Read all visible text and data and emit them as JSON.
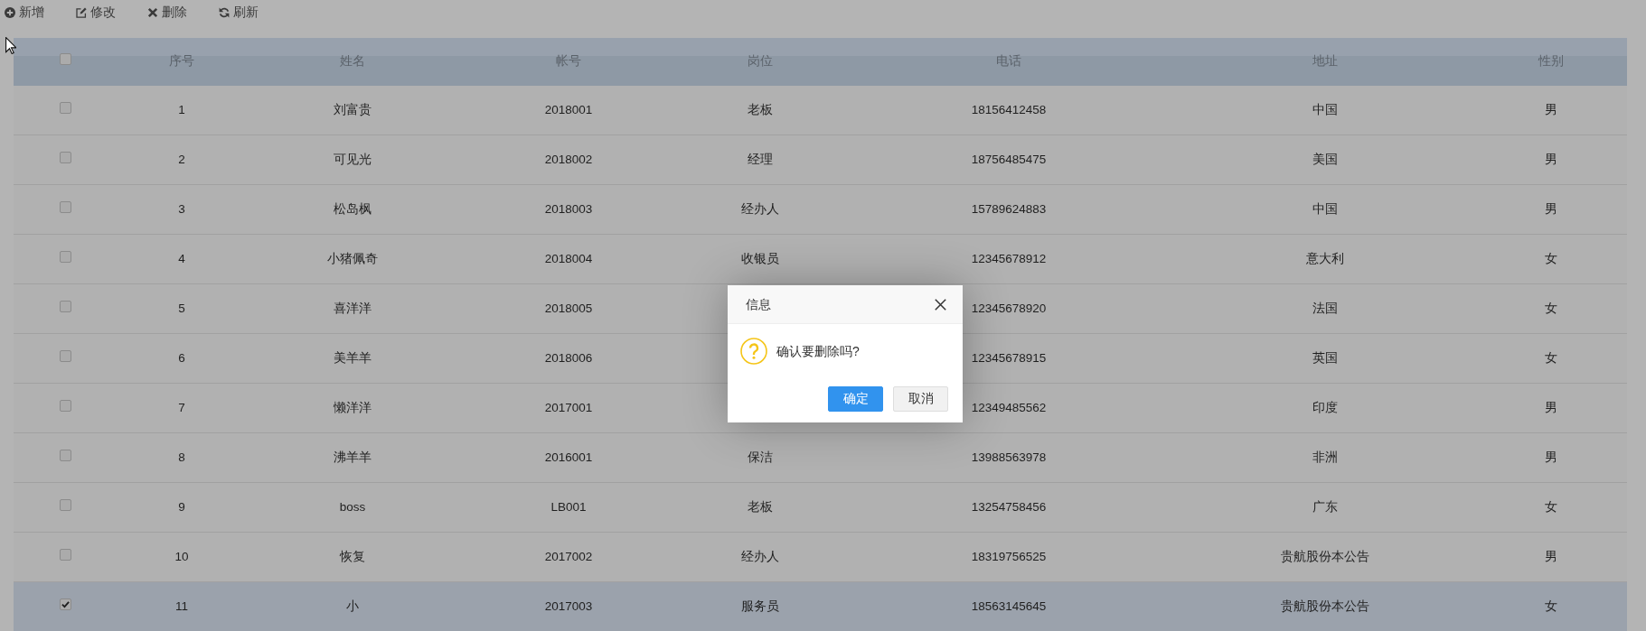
{
  "toolbar": [
    {
      "kind": "add",
      "label": "新增"
    },
    {
      "kind": "edit",
      "label": "修改"
    },
    {
      "kind": "delete",
      "label": "删除"
    },
    {
      "kind": "refresh",
      "label": "刷新"
    }
  ],
  "table": {
    "header_checkbox": {
      "checked": false
    },
    "columns": [
      "序号",
      "姓名",
      "帐号",
      "岗位",
      "电话",
      "地址",
      "性别"
    ],
    "rows": [
      {
        "checked": false,
        "selected": false,
        "cells": [
          "1",
          "刘富贵",
          "2018001",
          "老板",
          "18156412458",
          "中国",
          "男"
        ]
      },
      {
        "checked": false,
        "selected": false,
        "cells": [
          "2",
          "可见光",
          "2018002",
          "经理",
          "18756485475",
          "美国",
          "男"
        ]
      },
      {
        "checked": false,
        "selected": false,
        "cells": [
          "3",
          "松岛枫",
          "2018003",
          "经办人",
          "15789624883",
          "中国",
          "男"
        ]
      },
      {
        "checked": false,
        "selected": false,
        "cells": [
          "4",
          "小猪佩奇",
          "2018004",
          "收银员",
          "12345678912",
          "意大利",
          "女"
        ]
      },
      {
        "checked": false,
        "selected": false,
        "cells": [
          "5",
          "喜洋洋",
          "2018005",
          null,
          "12345678920",
          "法国",
          "女"
        ]
      },
      {
        "checked": false,
        "selected": false,
        "cells": [
          "6",
          "美羊羊",
          "2018006",
          null,
          "12345678915",
          "英国",
          "女"
        ]
      },
      {
        "checked": false,
        "selected": false,
        "cells": [
          "7",
          "懒洋洋",
          "2017001",
          null,
          "12349485562",
          "印度",
          "男"
        ]
      },
      {
        "checked": false,
        "selected": false,
        "cells": [
          "8",
          "沸羊羊",
          "2016001",
          "保洁",
          "13988563978",
          "非洲",
          "男"
        ]
      },
      {
        "checked": false,
        "selected": false,
        "cells": [
          "9",
          "boss",
          "LB001",
          "老板",
          "13254758456",
          "广东",
          "女"
        ]
      },
      {
        "checked": false,
        "selected": false,
        "cells": [
          "10",
          "恢复",
          "2017002",
          "经办人",
          "18319756525",
          "贵航股份本公告",
          "男"
        ]
      },
      {
        "checked": true,
        "selected": true,
        "cells": [
          "11",
          "小",
          "2017003",
          "服务员",
          "18563145645",
          "贵航股份本公告",
          "女"
        ]
      }
    ]
  },
  "dialog": {
    "title": "信息",
    "message": "确认要删除吗?",
    "buttons": [
      {
        "label": "确定",
        "primary": true
      },
      {
        "label": "取消",
        "primary": false
      }
    ]
  }
}
